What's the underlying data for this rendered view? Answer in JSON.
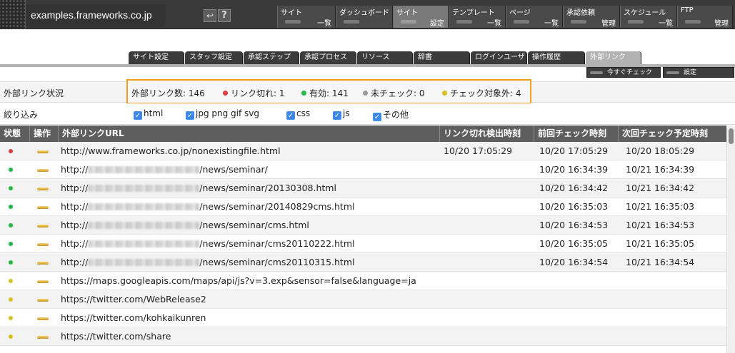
{
  "header": {
    "site_name": "examples.frameworks.co.jp",
    "menus": [
      {
        "label": "サイト",
        "sub": "一覧",
        "active": false,
        "width": 82
      },
      {
        "label": "ダッシュボード",
        "sub": "",
        "active": false,
        "width": 80
      },
      {
        "label": "サイト",
        "sub": "設定",
        "active": true,
        "width": 78
      },
      {
        "label": "テンプレート",
        "sub": "一覧",
        "active": false,
        "width": 80
      },
      {
        "label": "ページ",
        "sub": "一覧",
        "active": false,
        "width": 80
      },
      {
        "label": "承認依頼",
        "sub": "管理",
        "active": false,
        "width": 80
      },
      {
        "label": "スケジュール",
        "sub": "一覧",
        "active": false,
        "width": 80
      },
      {
        "label": "FTP",
        "sub": "管理",
        "active": false,
        "width": 78
      }
    ]
  },
  "tabs": [
    {
      "label": "サイト設定",
      "active": false
    },
    {
      "label": "スタッフ設定",
      "active": false
    },
    {
      "label": "承認ステップ",
      "active": false
    },
    {
      "label": "承認プロセス",
      "active": false
    },
    {
      "label": "リソース",
      "active": false
    },
    {
      "label": "辞書",
      "active": false
    },
    {
      "label": "ログインユーザ",
      "active": false
    },
    {
      "label": "操作履歴",
      "active": false
    },
    {
      "label": "外部リンク",
      "active": true
    }
  ],
  "toolbar": {
    "check_now": "今すぐチェック",
    "settings": "設定"
  },
  "status": {
    "label": "外部リンク状況",
    "total": "外部リンク数: 146",
    "broken": "リンク切れ: 1",
    "valid": "有効: 141",
    "unchecked": "未チェック: 0",
    "excluded": "チェック対象外: 4"
  },
  "filter": {
    "label": "絞り込み",
    "options": [
      "html",
      "jpg png gif svg",
      "css",
      "js",
      "その他"
    ]
  },
  "table": {
    "headers": {
      "state": "状態",
      "op": "操作",
      "url": "外部リンクURL",
      "broken_at": "リンク切れ検出時刻",
      "last_check": "前回チェック時刻",
      "next_check": "次回チェック予定時刻"
    },
    "rows": [
      {
        "state": "broken",
        "prefix": "http://www.frameworks.co.jp/nonexistingfile.html",
        "blurred": false,
        "suffix": "",
        "broken_at": "10/20 17:05:29",
        "last": "10/20 17:05:29",
        "next": "10/20 18:05:29"
      },
      {
        "state": "valid",
        "prefix": "http://",
        "blurred": true,
        "suffix": "/news/seminar/",
        "broken_at": "",
        "last": "10/20 16:34:39",
        "next": "10/21 16:34:39"
      },
      {
        "state": "valid",
        "prefix": "http://",
        "blurred": true,
        "suffix": "/news/seminar/20130308.html",
        "broken_at": "",
        "last": "10/20 16:34:42",
        "next": "10/21 16:34:42"
      },
      {
        "state": "valid",
        "prefix": "http://",
        "blurred": true,
        "suffix": "/news/seminar/20140829cms.html",
        "broken_at": "",
        "last": "10/20 16:35:03",
        "next": "10/21 16:35:03"
      },
      {
        "state": "valid",
        "prefix": "http://",
        "blurred": true,
        "suffix": "/news/seminar/cms.html",
        "broken_at": "",
        "last": "10/20 16:34:53",
        "next": "10/21 16:34:53"
      },
      {
        "state": "valid",
        "prefix": "http://",
        "blurred": true,
        "suffix": "/news/seminar/cms20110222.html",
        "broken_at": "",
        "last": "10/20 16:35:05",
        "next": "10/21 16:35:05"
      },
      {
        "state": "valid",
        "prefix": "http://",
        "blurred": true,
        "suffix": "/news/seminar/cms20110315.html",
        "broken_at": "",
        "last": "10/20 16:34:54",
        "next": "10/21 16:34:54"
      },
      {
        "state": "excluded",
        "prefix": "https://maps.googleapis.com/maps/api/js?v=3.exp&sensor=false&language=ja",
        "blurred": false,
        "suffix": "",
        "broken_at": "",
        "last": "",
        "next": ""
      },
      {
        "state": "excluded",
        "prefix": "https://twitter.com/WebRelease2",
        "blurred": false,
        "suffix": "",
        "broken_at": "",
        "last": "",
        "next": ""
      },
      {
        "state": "excluded",
        "prefix": "https://twitter.com/kohkaikunren",
        "blurred": false,
        "suffix": "",
        "broken_at": "",
        "last": "",
        "next": ""
      },
      {
        "state": "excluded",
        "prefix": "https://twitter.com/share",
        "blurred": false,
        "suffix": "",
        "broken_at": "",
        "last": "",
        "next": ""
      },
      {
        "state": "excluded",
        "prefix": "",
        "blurred": false,
        "suffix": "",
        "broken_at": "",
        "last": "",
        "next": ""
      }
    ]
  },
  "colors": {
    "broken": "#d94040",
    "valid": "#22b844",
    "unchecked": "#9a9a9a",
    "excluded": "#d8c020"
  }
}
